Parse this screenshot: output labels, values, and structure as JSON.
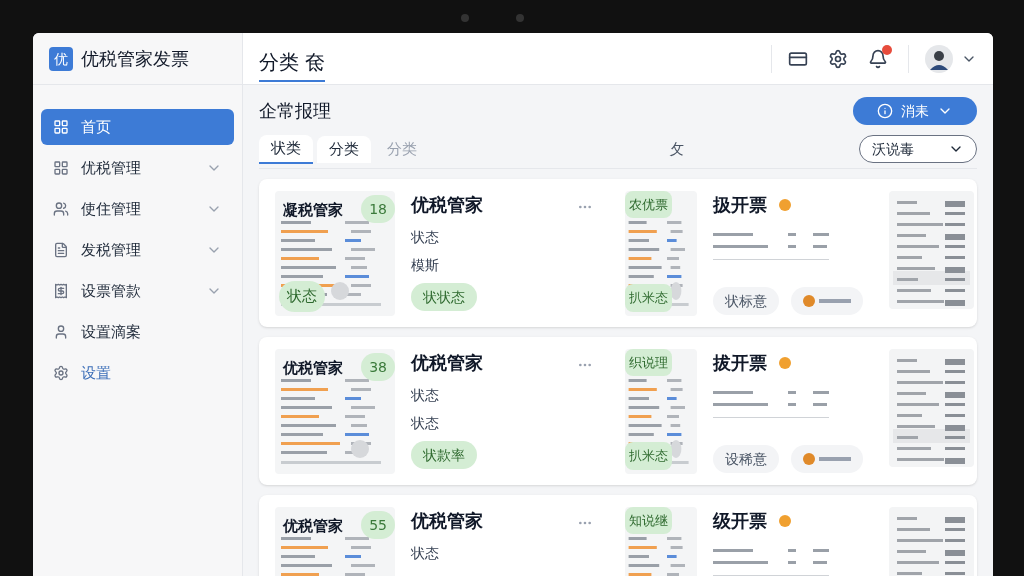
{
  "app": {
    "logo": "优",
    "name": "优税管家发票"
  },
  "sidebar": {
    "items": [
      {
        "label": "首页",
        "selected": true,
        "has_submenu": false,
        "kind": "normal"
      },
      {
        "label": "优税管理",
        "selected": false,
        "has_submenu": true,
        "kind": "normal"
      },
      {
        "label": "使住管理",
        "selected": false,
        "has_submenu": true,
        "kind": "normal"
      },
      {
        "label": "发税管理",
        "selected": false,
        "has_submenu": true,
        "kind": "normal"
      },
      {
        "label": "设票管款",
        "selected": false,
        "has_submenu": true,
        "kind": "normal"
      },
      {
        "label": "设置滴案",
        "selected": false,
        "has_submenu": false,
        "kind": "normal"
      },
      {
        "label": "设置",
        "selected": false,
        "has_submenu": false,
        "kind": "link"
      }
    ]
  },
  "header": {
    "title": "分类 奃"
  },
  "page": {
    "title": "企常报理",
    "action_button": "消耒",
    "tabs": [
      {
        "label": "状类",
        "selected": true,
        "disabled": false
      },
      {
        "label": "分类",
        "selected": false,
        "disabled": false
      },
      {
        "label": "分类",
        "selected": false,
        "disabled": true
      }
    ],
    "center_label": "攵",
    "filter": {
      "value": "沃说毒"
    }
  },
  "cards": [
    {
      "doc_title": "凝税管家",
      "count": "18",
      "doc_chip": "状态",
      "title": "优税管家",
      "lines": [
        "状态",
        "模斯"
      ],
      "chip": "状状态",
      "thumb_top": "农优票",
      "thumb_bottom": "扒米态",
      "title2": "扱开票",
      "chip2": "状标意"
    },
    {
      "doc_title": "优税管家",
      "count": "38",
      "title": "优税管家",
      "lines": [
        "状态",
        "状态"
      ],
      "chip": "状款率",
      "thumb_top": "织说理",
      "thumb_bottom": "扒米态",
      "title2": "拔开票",
      "chip2": "设稀意"
    },
    {
      "doc_title": "优税管家",
      "count": "55",
      "title": "优税管家",
      "lines": [
        "状态"
      ],
      "thumb_top": "知说继",
      "title2": "级开票"
    }
  ]
}
